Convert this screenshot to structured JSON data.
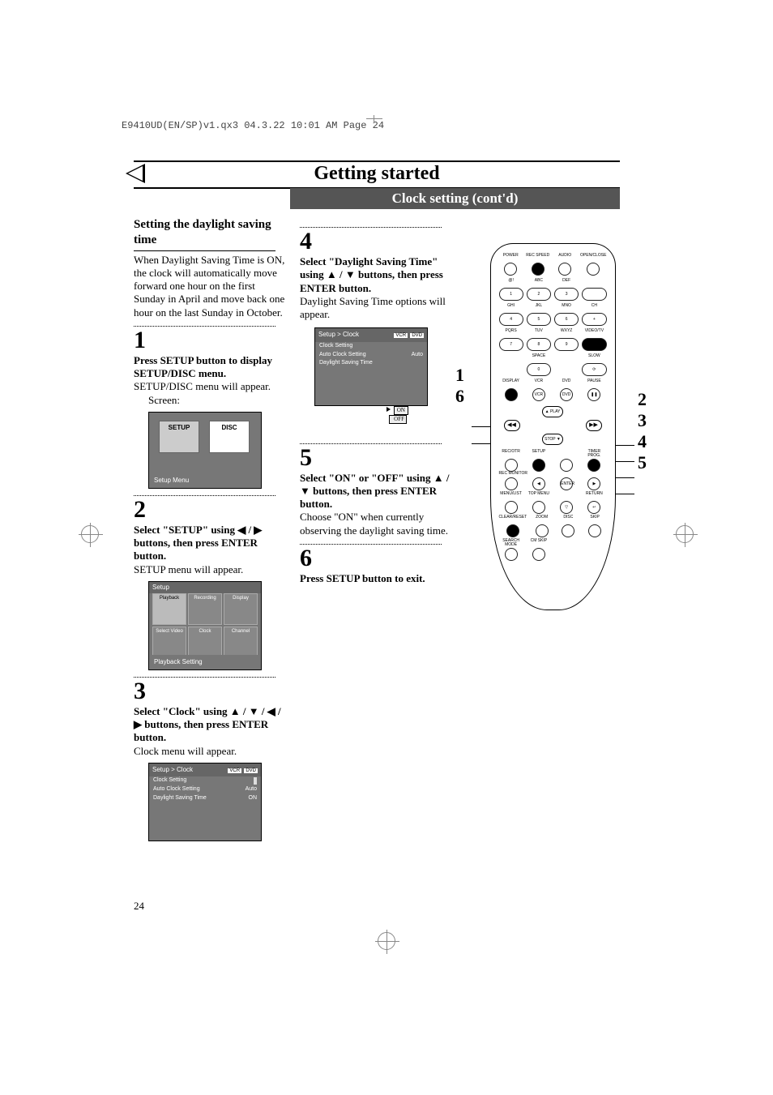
{
  "header_line": "E9410UD(EN/SP)v1.qx3  04.3.22  10:01 AM  Page 24",
  "page_title": "Getting started",
  "sub_title": "Clock setting (cont'd)",
  "page_number": "24",
  "left_col": {
    "section_title": "Setting the daylight saving time",
    "intro": "When Daylight Saving Time is ON, the clock will automatically move forward one hour on the first Sunday in April and move back one hour on the last Sunday in October.",
    "step1_num": "1",
    "step1_bold": "Press SETUP button to display SETUP/DISC menu.",
    "step1_text": "SETUP/DISC menu will appear.",
    "step1_sub": "Screen:",
    "sd_tile_setup": "SETUP",
    "sd_tile_disc": "DISC",
    "sd_caption": "Setup Menu",
    "step2_num": "2",
    "step2_bold": "Select \"SETUP\" using ◀ / ▶ buttons, then press ENTER button.",
    "step2_text": "SETUP menu will appear.",
    "setup_hd": "Setup",
    "setup_tiles": [
      "Playback",
      "Recording",
      "Display",
      "Select Video",
      "Clock",
      "Channel"
    ],
    "setup_caption": "Playback Setting",
    "step3_num": "3",
    "step3_bold": "Select \"Clock\" using ▲ / ▼ / ◀ / ▶ buttons, then press ENTER button.",
    "step3_text": "Clock menu will appear.",
    "clock_hd": "Setup > Clock",
    "clock_tags": [
      "VCR",
      "DVD"
    ],
    "clock_rows": [
      {
        "k": "Clock Setting",
        "v": ""
      },
      {
        "k": "Auto Clock Setting",
        "v": "Auto"
      },
      {
        "k": "Daylight Saving Time",
        "v": "ON"
      }
    ]
  },
  "mid_col": {
    "step4_num": "4",
    "step4_bold": "Select \"Daylight Saving Time\" using ▲ / ▼ buttons, then press ENTER button.",
    "step4_text": "Daylight Saving Time options will appear.",
    "clock2_hd": "Setup > Clock",
    "clock2_tags": [
      "VCR",
      "DVD"
    ],
    "clock2_rows": [
      {
        "k": "Clock Setting",
        "v": ""
      },
      {
        "k": "Auto Clock Setting",
        "v": "Auto"
      },
      {
        "k": "Daylight Saving Time",
        "v": ""
      }
    ],
    "on_label": "ON",
    "off_label": "OFF",
    "step5_num": "5",
    "step5_bold": "Select \"ON\" or \"OFF\" using ▲ / ▼ buttons, then press ENTER button.",
    "step5_text": "Choose \"ON\" when currently observing the daylight saving time.",
    "step6_num": "6",
    "step6_bold": "Press SETUP button to exit."
  },
  "remote": {
    "row1_labels": [
      "POWER",
      "REC SPEED",
      "AUDIO",
      "OPEN/CLOSE"
    ],
    "numpad_sub": [
      "@!",
      "ABC",
      "DEF",
      "",
      "GHI",
      "JKL",
      "MNO",
      "CH",
      "PQRS",
      "TUV",
      "WXYZ",
      "VIDEO/TV"
    ],
    "numpad": [
      "1",
      "2",
      "3",
      "",
      "4",
      "5",
      "6",
      "+",
      "7",
      "8",
      "9",
      "●"
    ],
    "row_space": [
      "",
      "SPACE",
      "",
      "SLOW"
    ],
    "row_zero": [
      "",
      "0",
      "",
      "⟳"
    ],
    "row_disp_lbl": [
      "DISPLAY",
      "VCR",
      "DVD",
      "PAUSE"
    ],
    "row_disp": [
      "●",
      "VCR",
      "DVD",
      "❚❚"
    ],
    "nav_play": "▲ PLAY",
    "nav_stop": "STOP ▼",
    "nav_left": "◀◀",
    "nav_right": "▶▶",
    "row_rec_lbl": [
      "REC/OTR",
      "SETUP",
      "",
      "TIMER PROG."
    ],
    "row_rec": [
      "●",
      "●",
      "○",
      "●"
    ],
    "row_mon_lbl": "REC MONITOR",
    "row_mon": [
      "○",
      "◀",
      "ENTER",
      "▶"
    ],
    "row_menu_lbl": [
      "MENU/LIST",
      "TOP MENU",
      "",
      "RETURN"
    ],
    "row_menu": [
      "○",
      "○",
      "▽",
      "↩"
    ],
    "row_clr_lbl": [
      "CLEAR/RESET",
      "ZOOM",
      "DISC",
      "SKIP"
    ],
    "row_clr": [
      "●",
      "○",
      "⦿",
      "⦿"
    ],
    "row_last": [
      "SEARCH MODE",
      "CM SKIP"
    ],
    "row_last_b": [
      "○",
      "○"
    ]
  },
  "callouts_left": {
    "c1": "1",
    "c6": "6"
  },
  "callouts_right": {
    "c2": "2",
    "c3": "3",
    "c4": "4",
    "c5": "5"
  }
}
